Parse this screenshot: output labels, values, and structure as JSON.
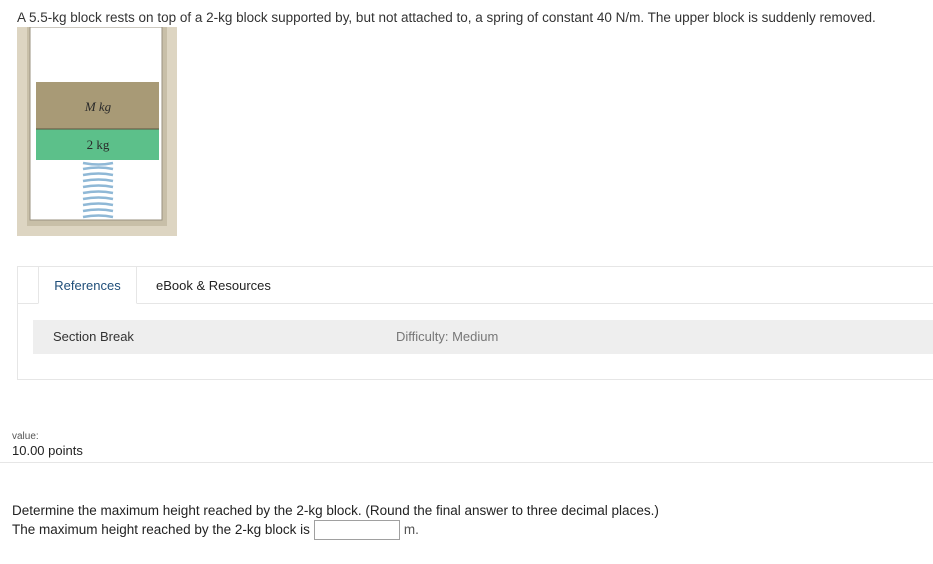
{
  "problem": {
    "text": "A 5.5-kg block rests on top of a 2-kg block supported by, but not attached to, a spring of constant 40 N/m. The upper block is suddenly removed."
  },
  "figure": {
    "upper_block_label": "M kg",
    "lower_block_label": "2 kg",
    "colors": {
      "frame": "#ddd5c2",
      "upper_block": "#a89a76",
      "lower_block": "#5cc08a",
      "spring": "#9fc6e0"
    }
  },
  "tabs": [
    {
      "label": "References",
      "active": true
    },
    {
      "label": "eBook & Resources",
      "active": false
    }
  ],
  "section": {
    "title": "Section Break",
    "difficulty": "Difficulty: Medium"
  },
  "value": {
    "label": "value:",
    "points": "10.00 points"
  },
  "question": {
    "prompt": "Determine the maximum height reached by the 2-kg block. (Round the final answer to three decimal places.)",
    "answer_prefix": "The maximum height reached by the 2-kg block is",
    "answer_value": "",
    "unit": "m."
  }
}
